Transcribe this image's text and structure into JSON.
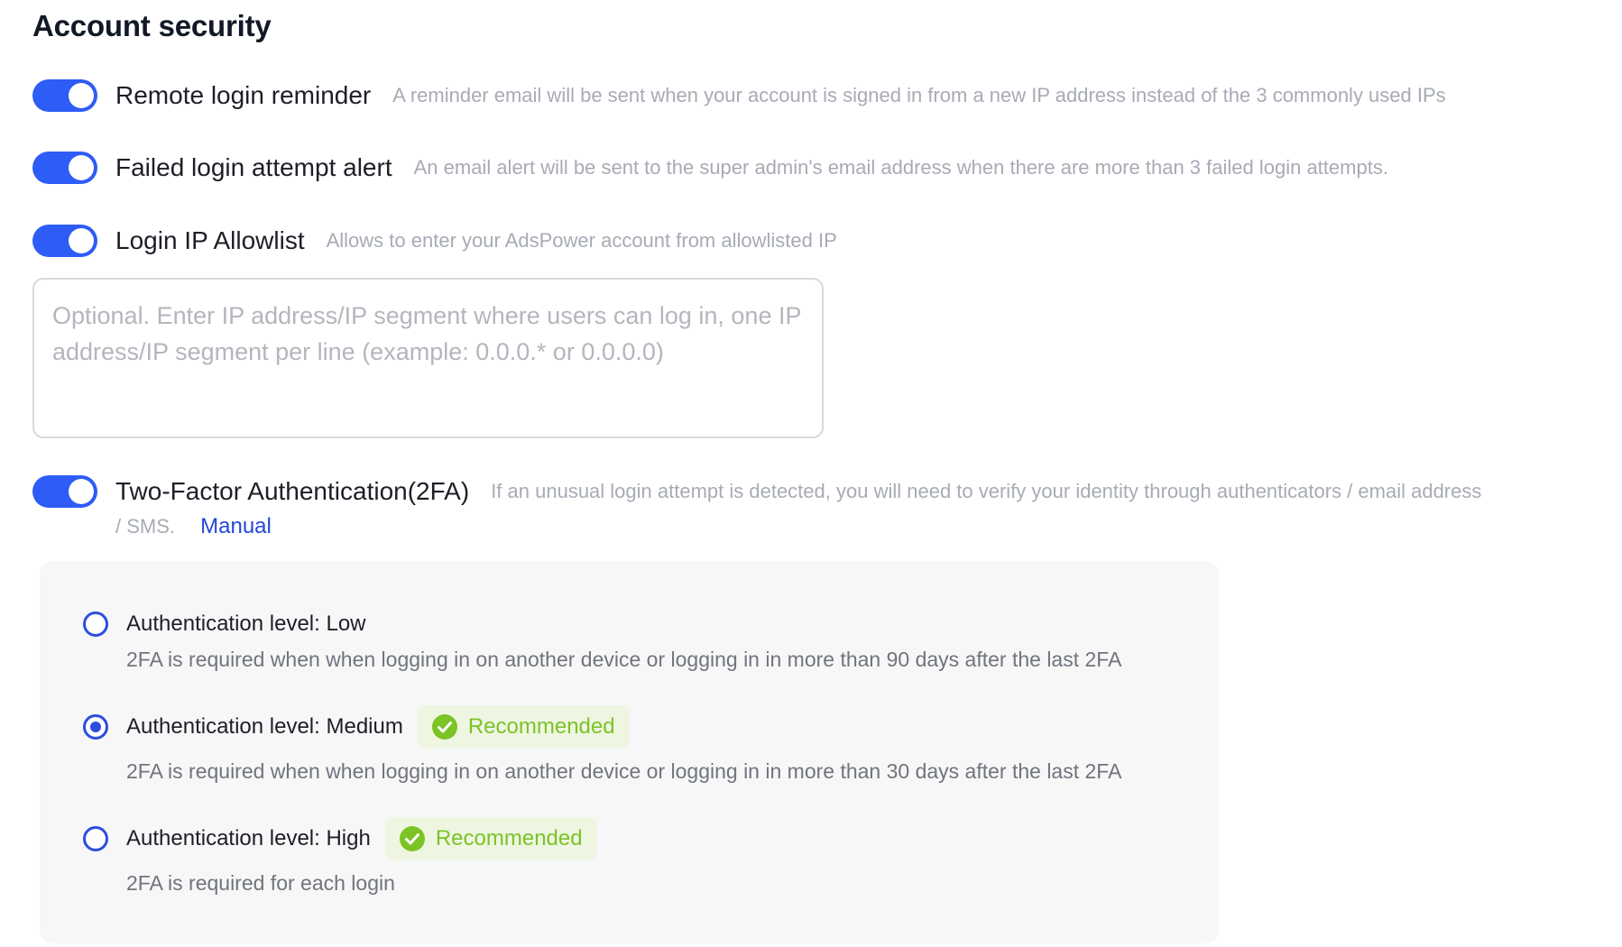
{
  "page": {
    "title": "Account security"
  },
  "settings": [
    {
      "label": "Remote login reminder",
      "description": "A reminder email will be sent when your account is signed in from a new IP address instead of the 3 commonly used IPs",
      "enabled": true
    },
    {
      "label": "Failed login attempt alert",
      "description": "An email alert will be sent to the super admin's email address when there are more than 3 failed login attempts.",
      "enabled": true
    },
    {
      "label": "Login IP Allowlist",
      "description": "Allows to enter your AdsPower account from allowlisted IP",
      "enabled": true
    },
    {
      "label": "Two-Factor Authentication(2FA)",
      "description": "If an unusual login attempt is detected, you will need to verify your identity through authenticators / email address",
      "description_cont": "/ SMS.",
      "link_label": "Manual",
      "enabled": true
    }
  ],
  "allowlist": {
    "value": "",
    "placeholder": "Optional. Enter IP address/IP segment where users can log in, one IP address/IP segment per line (example: 0.0.0.* or 0.0.0.0)"
  },
  "auth_levels": [
    {
      "label": "Authentication level: Low",
      "description": "2FA is required when when logging in on another device or logging in in more than 90 days after the last 2FA",
      "selected": false,
      "badge": ""
    },
    {
      "label": "Authentication level: Medium",
      "description": "2FA is required when when logging in on another device or logging in in more than 30 days after the last 2FA",
      "selected": true,
      "badge": "Recommended"
    },
    {
      "label": "Authentication level: High",
      "description": "2FA is required for each login",
      "selected": false,
      "badge": "Recommended"
    }
  ],
  "colors": {
    "accent": "#2d5cf6",
    "radio": "#2d4de0",
    "success": "#7cc326",
    "success_bg": "#eef6e2",
    "link": "#2546d8"
  },
  "icons": {
    "badge_icon": "check-circle-icon"
  }
}
